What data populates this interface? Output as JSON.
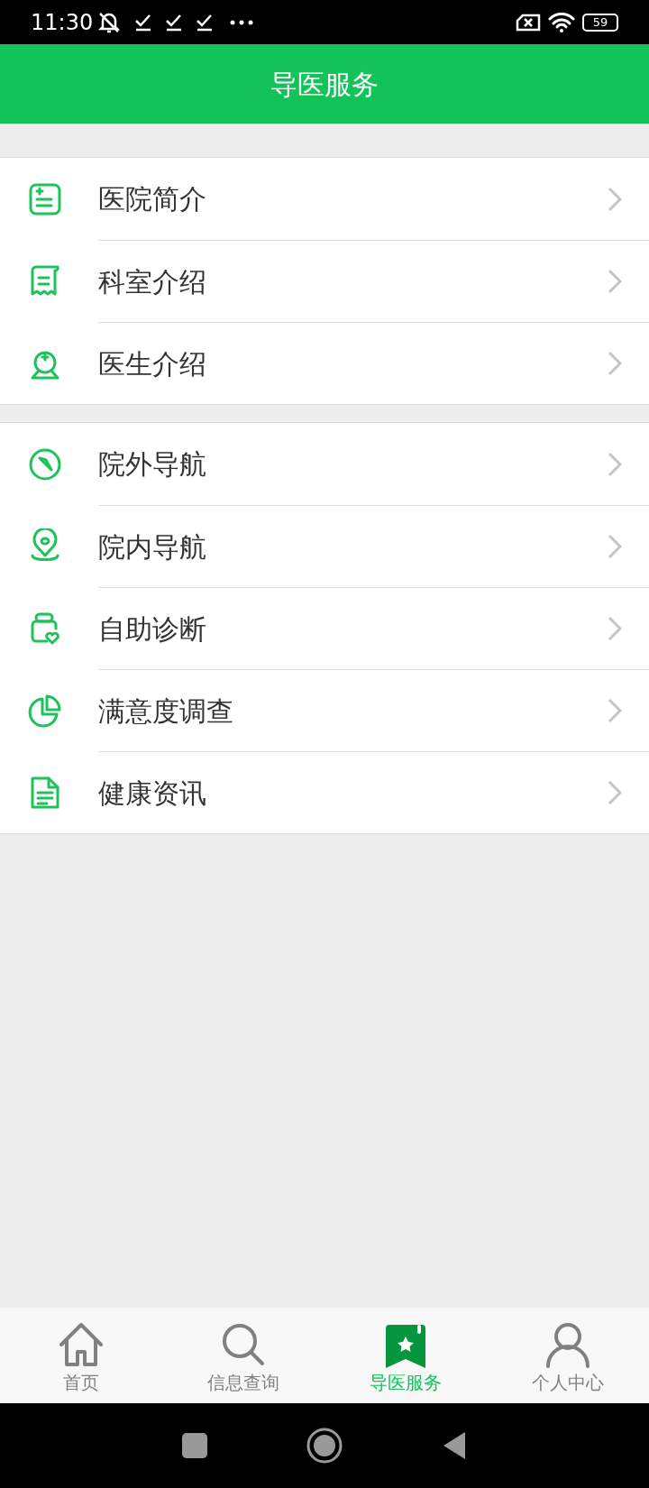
{
  "status_bar": {
    "time": "11:30",
    "battery": "59"
  },
  "header": {
    "title": "导医服务"
  },
  "groups": [
    {
      "items": [
        {
          "label": "医院简介"
        },
        {
          "label": "科室介绍"
        },
        {
          "label": "医生介绍"
        }
      ]
    },
    {
      "items": [
        {
          "label": "院外导航"
        },
        {
          "label": "院内导航"
        },
        {
          "label": "自助诊断"
        },
        {
          "label": "满意度调查"
        },
        {
          "label": "健康资讯"
        }
      ]
    }
  ],
  "tabs": [
    {
      "label": "首页",
      "selected": false
    },
    {
      "label": "信息查询",
      "selected": false
    },
    {
      "label": "导医服务",
      "selected": true
    },
    {
      "label": "个人中心",
      "selected": false
    }
  ]
}
